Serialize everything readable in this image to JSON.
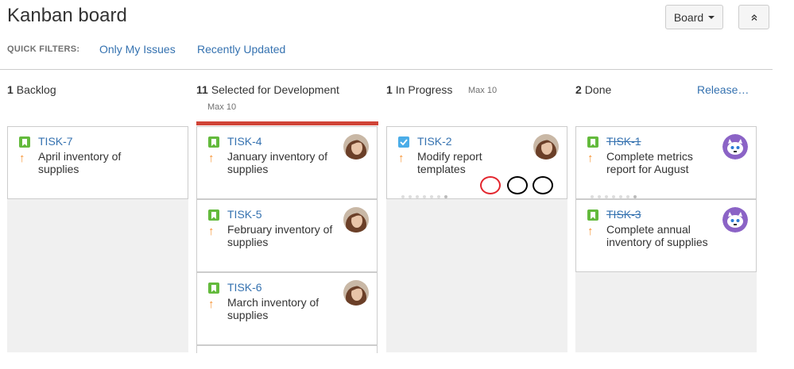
{
  "header": {
    "title": "Kanban board",
    "board_button": "Board",
    "collapse_icon": "double-chevron-up-icon"
  },
  "quick_filters": {
    "label": "QUICK FILTERS:",
    "items": [
      "Only My Issues",
      "Recently Updated"
    ]
  },
  "columns": [
    {
      "count": "1",
      "name": "Backlog",
      "max": ""
    },
    {
      "count": "11",
      "name": "Selected for Development",
      "max": "Max 10"
    },
    {
      "count": "1",
      "name": "In Progress",
      "max": "Max 10"
    },
    {
      "count": "2",
      "name": "Done",
      "max": ""
    }
  ],
  "release_link": "Release…",
  "cards": [
    {
      "key": "TISK-7",
      "summary": "April inventory of supplies",
      "type": "story",
      "priority_icon": "arrow-up-icon",
      "assignee": ""
    },
    {
      "key": "TISK-4",
      "summary": "January inventory of supplies",
      "type": "story",
      "priority_icon": "arrow-up-icon",
      "assignee": "woman-avatar"
    },
    {
      "key": "TISK-5",
      "summary": "February inventory of supplies",
      "type": "story",
      "priority_icon": "arrow-up-icon",
      "assignee": "woman-avatar"
    },
    {
      "key": "TISK-6",
      "summary": "March inventory of supplies",
      "type": "story",
      "priority_icon": "arrow-up-icon",
      "assignee": "woman-avatar"
    },
    {
      "key": "TISK-2",
      "summary": "Modify report templates",
      "type": "task",
      "priority_icon": "arrow-up-icon",
      "assignee": "woman-avatar"
    },
    {
      "key": "TISK-1",
      "summary": "Complete metrics report for August",
      "type": "story",
      "priority_icon": "arrow-up-icon",
      "assignee": "robot-avatar",
      "done": true
    },
    {
      "key": "TISK-3",
      "summary": "Complete annual inventory of supplies",
      "type": "story",
      "priority_icon": "arrow-up-icon",
      "assignee": "robot-avatar",
      "done": true
    }
  ],
  "colors": {
    "link": "#3572b0",
    "story": "#63ba3c",
    "task": "#4bade8",
    "priority": "#f79232",
    "wip_exceeded": "#d04437",
    "column_bg": "#f0f0f0"
  }
}
